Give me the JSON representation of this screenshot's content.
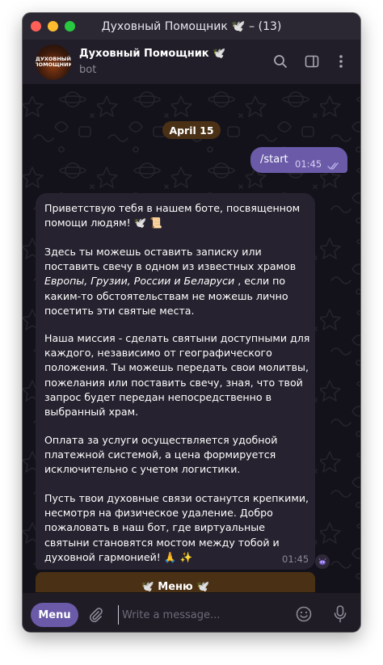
{
  "window": {
    "title": "Духовный Помощник 🕊️ – (13)"
  },
  "header": {
    "avatar_text": "ДУХОВНЫЙ ПОМОЩНИК",
    "bot_name": "Духовный Помощник 🕊️",
    "bot_status": "bot",
    "icons": [
      "search-icon",
      "sidebar-toggle-icon",
      "more-vertical-icon"
    ]
  },
  "chat": {
    "date": "April 15",
    "outgoing": {
      "text": "/start",
      "time": "01:45"
    },
    "incoming": {
      "p1": "Приветствую тебя в нашем боте, посвященном помощи людям! 🕊️ 📜",
      "p2_before": "Здесь ты можешь оставить записку или поставить свечу в одном из известных храмов ",
      "p2_italic": "Европы, Грузии, России и Беларуси",
      "p2_after": " , если по каким-то обстоятельствам не можешь лично посетить эти святые места.",
      "p3": "Наша миссия - сделать святыни доступными для каждого, независимо от географического положения. Ты можешь передать свои молитвы, пожелания или поставить свечу, зная, что твой запрос будет передан непосредственно в выбранный храм.",
      "p4": "Оплата за услуги осуществляется удобной платежной системой, а цена формируется исключительно с учетом логистики.",
      "p5": "Пусть твои духовные связи останутся крепкими, несмотря на физическое удаление. Добро пожаловать в наш бот, где виртуальные святыни становятся мостом между тобой и духовной гармонией! 🙏 ✨",
      "time": "01:45"
    },
    "inline_button": "🕊️ Меню 🕊️"
  },
  "input": {
    "menu_label": "Menu",
    "placeholder": "Write a message..."
  },
  "colors": {
    "accent": "#6a5aa8",
    "button_brown": "#4a3014",
    "bubble_in": "#26222f",
    "chat_bg": "#13121a"
  }
}
